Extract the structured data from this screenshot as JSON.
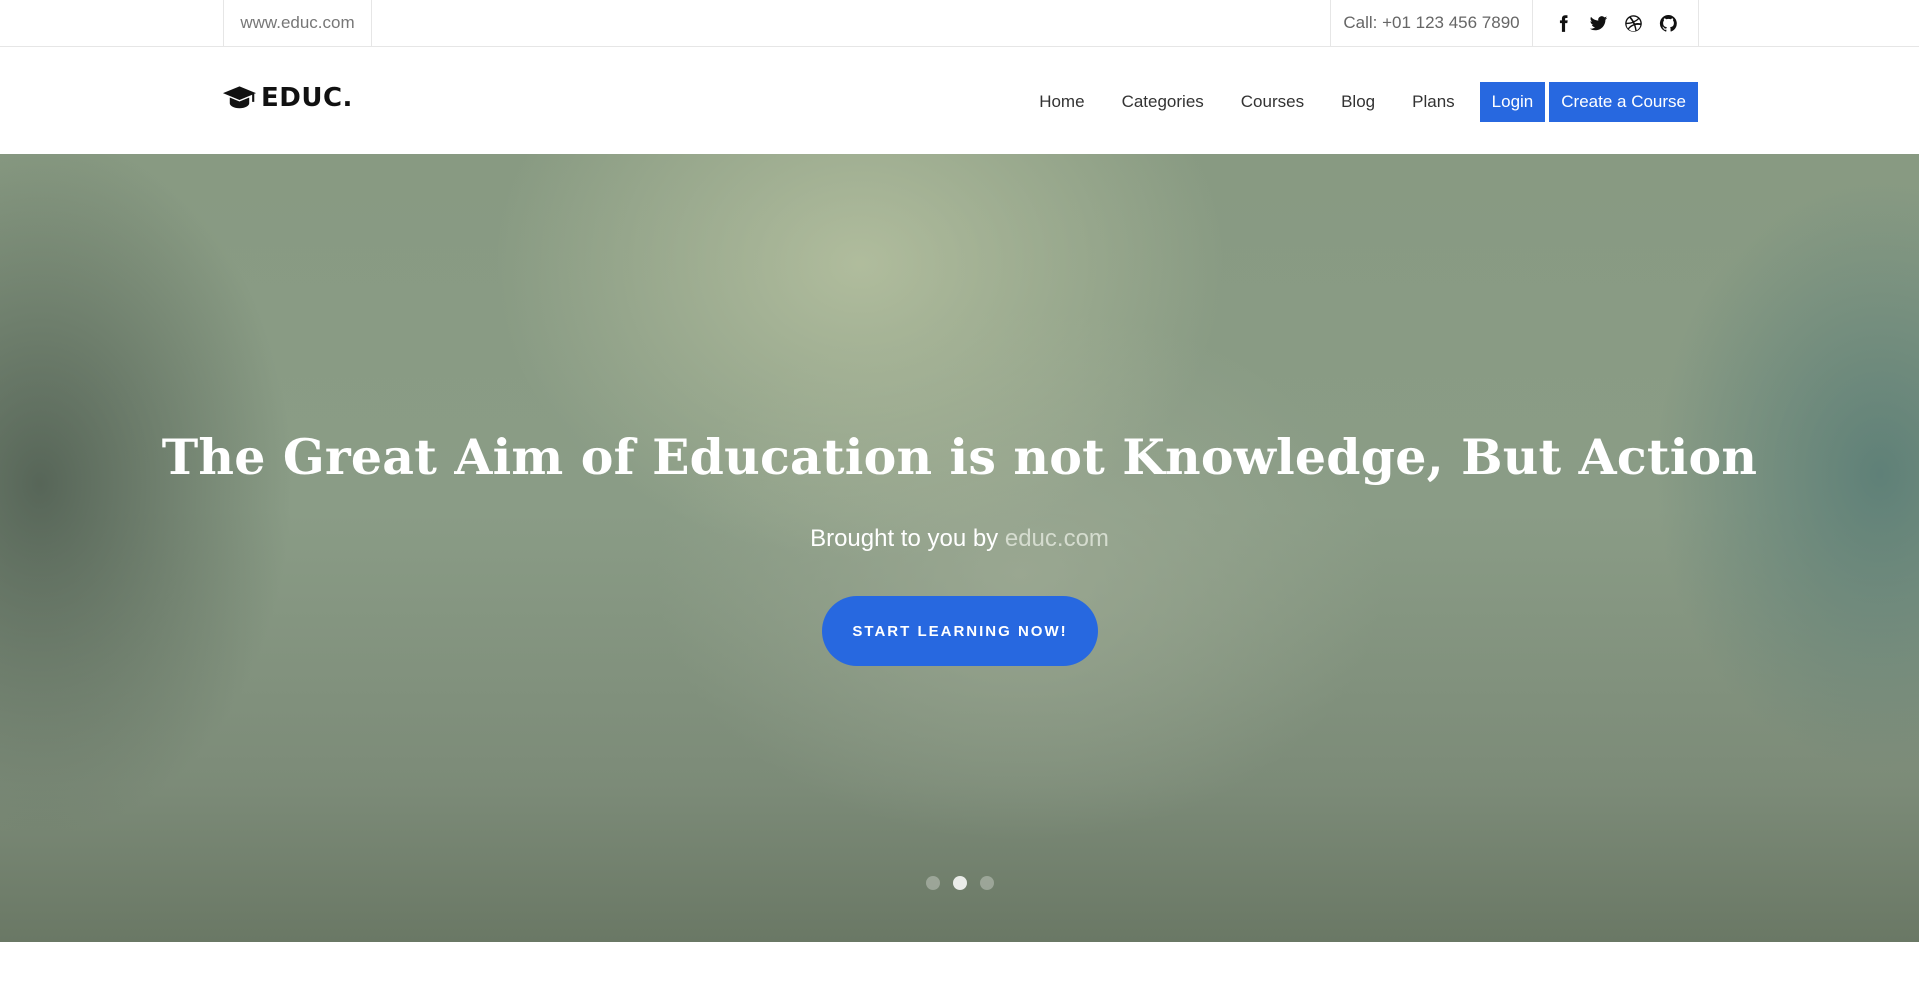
{
  "topbar": {
    "website": "www.educ.com",
    "call": "Call: +01 123 456 7890",
    "social_icons": [
      "facebook-icon",
      "twitter-icon",
      "dribbble-icon",
      "github-icon"
    ]
  },
  "header": {
    "brand": "EDUC.",
    "logo_icon": "graduation-cap-icon",
    "nav": [
      "Home",
      "Categories",
      "Courses",
      "Blog",
      "Plans"
    ],
    "login_label": "Login",
    "create_label": "Create a Course"
  },
  "hero": {
    "title": "The Great Aim of Education is not Knowledge, But Action",
    "subtitle_prefix": "Brought to you by",
    "subtitle_link": "educ.com",
    "cta_label": "START LEARNING NOW!",
    "slides_total": 3,
    "active_slide": 2
  },
  "colors": {
    "accent": "#2768e0",
    "hero_text": "#ffffff"
  }
}
